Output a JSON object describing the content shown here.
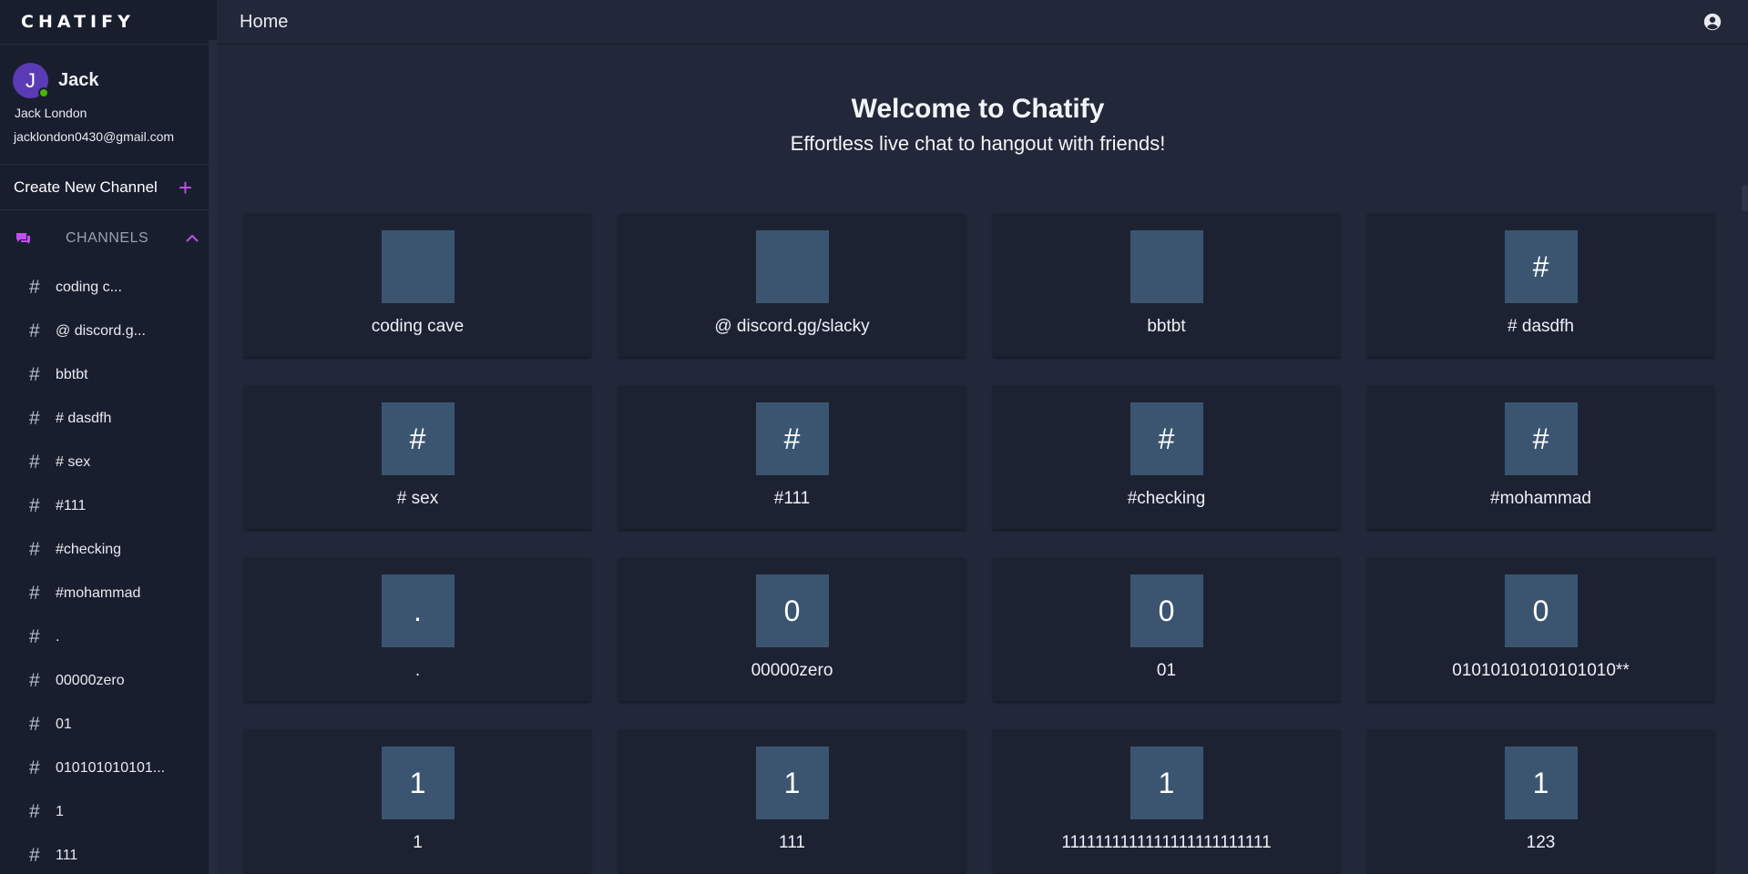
{
  "app": {
    "logo": "CHATIFY"
  },
  "header": {
    "title": "Home",
    "account_icon": "account-circle-icon"
  },
  "profile": {
    "initial": "J",
    "name": "Jack",
    "full_name": "Jack London",
    "email": "jacklondon0430@gmail.com",
    "status_color": "#44b700"
  },
  "sidebar": {
    "create_channel_label": "Create New Channel",
    "create_icon": "plus-icon",
    "channels_label": "CHANNELS",
    "channels": [
      "coding c...",
      "@ discord.g...",
      "bbtbt",
      "# dasdfh",
      "# sex",
      "#111",
      "#checking",
      "#mohammad",
      ".",
      "00000zero",
      "01",
      "010101010101...",
      "1",
      "111"
    ]
  },
  "main": {
    "welcome_title": "Welcome to Chatify",
    "welcome_subtitle": "Effortless live chat to hangout with friends!",
    "cards": [
      {
        "symbol": "",
        "name": "coding cave"
      },
      {
        "symbol": "",
        "name": "@ discord.gg/slacky"
      },
      {
        "symbol": "",
        "name": "bbtbt"
      },
      {
        "symbol": "#",
        "name": "# dasdfh"
      },
      {
        "symbol": "#",
        "name": "# sex"
      },
      {
        "symbol": "#",
        "name": "#111"
      },
      {
        "symbol": "#",
        "name": "#checking"
      },
      {
        "symbol": "#",
        "name": "#mohammad"
      },
      {
        "symbol": ".",
        "name": "."
      },
      {
        "symbol": "0",
        "name": "00000zero"
      },
      {
        "symbol": "0",
        "name": "01"
      },
      {
        "symbol": "0",
        "name": "01010101010101010**"
      },
      {
        "symbol": "1",
        "name": "1"
      },
      {
        "symbol": "1",
        "name": "111"
      },
      {
        "symbol": "1",
        "name": "1111111111111111111111111"
      },
      {
        "symbol": "1",
        "name": "123"
      }
    ]
  },
  "colors": {
    "accent": "#c04ff0",
    "sidebar_bg": "#191e2e",
    "main_bg": "#222839",
    "card_bg": "#1d2233",
    "card_avatar_bg": "#3b5570",
    "avatar_bg": "#5b3bb5"
  }
}
